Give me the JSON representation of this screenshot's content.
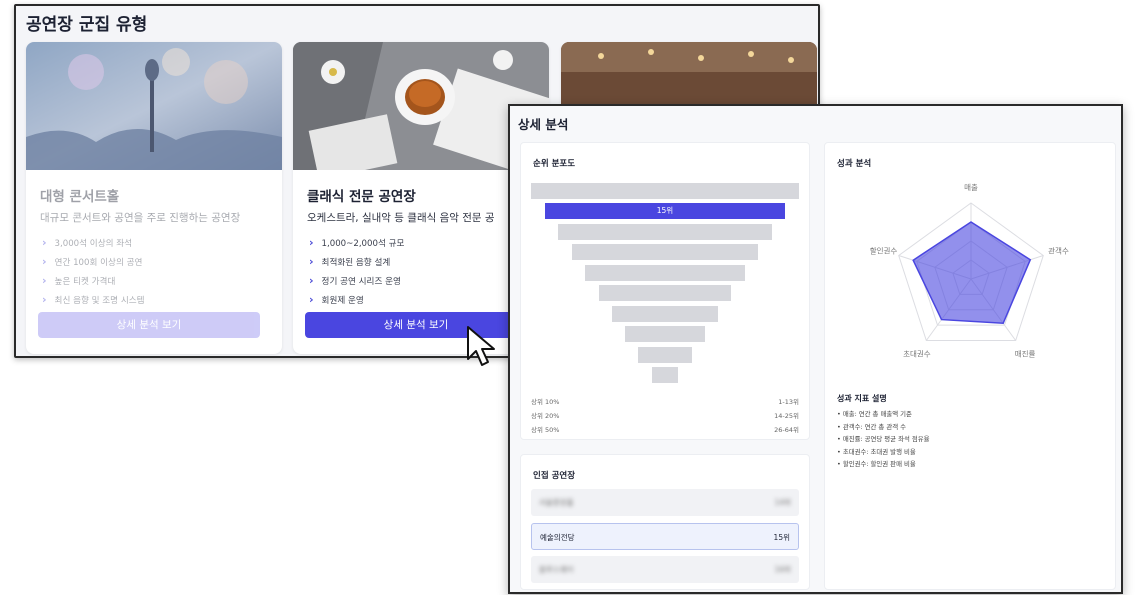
{
  "back": {
    "title": "공연장 군집 유형",
    "cards": [
      {
        "title": "대형 콘서트홀",
        "desc": "대규모 콘서트와 공연을 주로 진행하는 공연장",
        "features": [
          "3,000석 이상의 좌석",
          "연간 100회 이상의 공연",
          "높은 티켓 가격대",
          "최신 음향 및 조명 시스템"
        ],
        "button": "상세 분석 보기"
      },
      {
        "title": "클래식 전문 공연장",
        "desc": "오케스트라, 실내악 등 클래식 음악 전문 공",
        "features": [
          "1,000~2,000석 규모",
          "최적화된 음향 설계",
          "정기 공연 시리즈 운영",
          "회원제 운영"
        ],
        "button": "상세 분석 보기"
      }
    ]
  },
  "front": {
    "title": "상세 분석",
    "rank_panel": {
      "title": "순위 분포도",
      "highlight_label": "15위",
      "legend": [
        {
          "label": "상위 10%",
          "range": "1-13위"
        },
        {
          "label": "상위 20%",
          "range": "14-25위"
        },
        {
          "label": "상위 50%",
          "range": "26-64위"
        }
      ]
    },
    "neighbors_panel": {
      "title": "인접 공연장",
      "items": [
        {
          "name": "서울중앙홀",
          "rank": "14위",
          "blurred": true
        },
        {
          "name": "예술의전당",
          "rank": "15위",
          "blurred": false
        },
        {
          "name": "블루스퀘어",
          "rank": "16위",
          "blurred": true
        }
      ]
    },
    "perf_panel": {
      "title": "성과 분석",
      "radar_axes": [
        "매출",
        "관객수",
        "매진률",
        "초대권수",
        "할인권수"
      ],
      "radar_values": [
        0.75,
        0.82,
        0.72,
        0.66,
        0.8
      ],
      "radar_color": "#4a46e0",
      "explain_title": "성과 지표 설명",
      "explanations": [
        "매출: 연간 총 매출액 기준",
        "관객수: 연간 총 관객 수",
        "매진률: 공연당 평균 좌석 점유율",
        "초대권수: 초대권 발행 비율",
        "할인권수: 할인권 판매 비율"
      ]
    }
  }
}
